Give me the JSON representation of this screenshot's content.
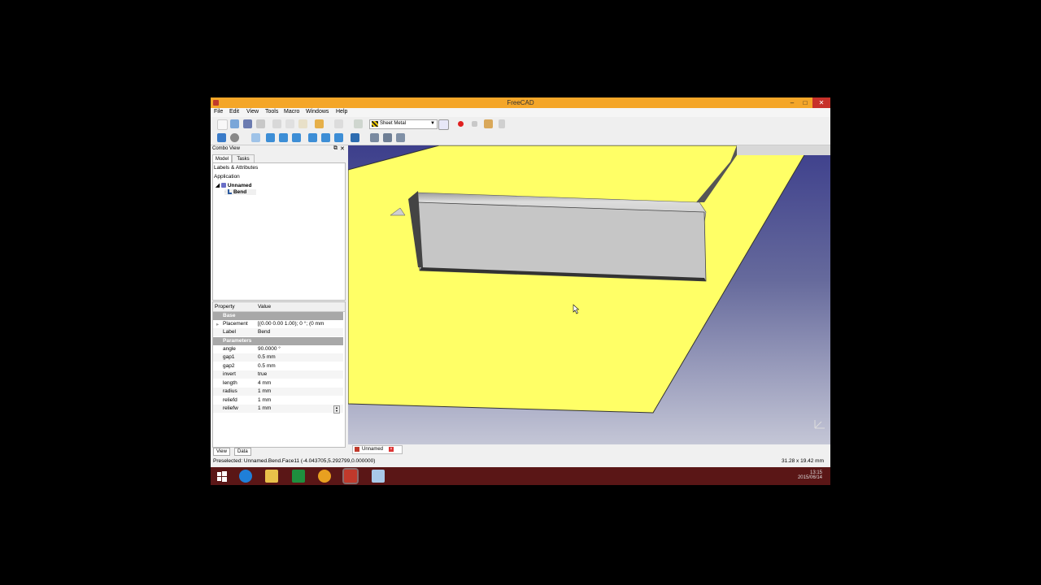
{
  "window": {
    "title": "FreeCAD",
    "minimize": "–",
    "maximize": "□",
    "close": "✕"
  },
  "menu": [
    "File",
    "Edit",
    "View",
    "Tools",
    "Macro",
    "Windows",
    "Help"
  ],
  "toolbar": {
    "workbench": "Sheet Metal"
  },
  "combo": {
    "title": "Combo View",
    "tabs": [
      "Model",
      "Tasks"
    ],
    "tree": {
      "header": "Labels & Attributes",
      "root": "Application",
      "document": "Unnamed",
      "object": "Bend"
    },
    "property_header": {
      "property": "Property",
      "value": "Value"
    },
    "groups": [
      {
        "name": "Base",
        "rows": [
          {
            "key": "Placement",
            "value": "[(0.00 0.00 1.00); 0 °; (0 mm"
          },
          {
            "key": "Label",
            "value": "Bend"
          }
        ]
      },
      {
        "name": "Parameters",
        "rows": [
          {
            "key": "angle",
            "value": "90.0000 °"
          },
          {
            "key": "gap1",
            "value": "0.5 mm"
          },
          {
            "key": "gap2",
            "value": "0.5 mm"
          },
          {
            "key": "invert",
            "value": "true"
          },
          {
            "key": "length",
            "value": "4 mm"
          },
          {
            "key": "radius",
            "value": "1 mm"
          },
          {
            "key": "reliefd",
            "value": "1 mm"
          },
          {
            "key": "reliefw",
            "value": "1 mm"
          }
        ]
      }
    ],
    "bottom_tabs": [
      "View",
      "Data"
    ]
  },
  "document_tab": "Unnamed",
  "statusbar": {
    "preselected": "Preselected: Unnamed.Bend.Face11 (-4.043705,5.292799,0.000000)",
    "dimensions": "31.28 x 19.42 mm"
  },
  "taskbar": {
    "time": "13:15",
    "date": "2015/06/14"
  },
  "colors": {
    "titlebar": "#f4a628",
    "sheet": "#ffff66",
    "bend": "#c4c4c4",
    "viewport_bg": "#414a90",
    "taskbar": "#5a1616"
  }
}
